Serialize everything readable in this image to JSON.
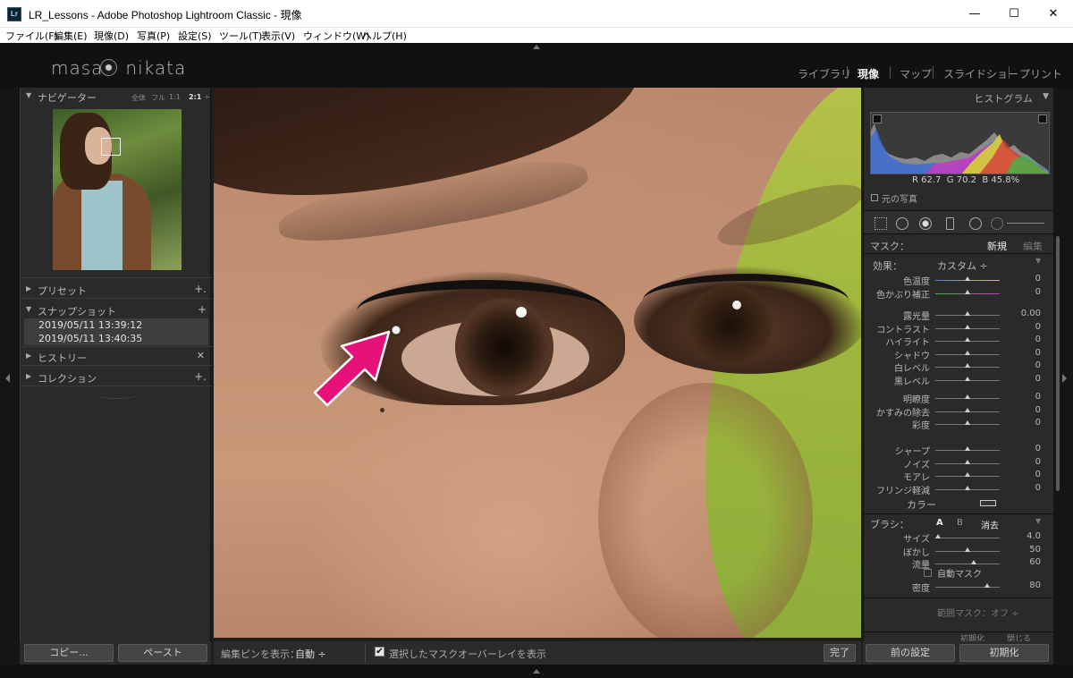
{
  "window": {
    "title": "LR_Lessons - Adobe Photoshop Lightroom Classic - 現像",
    "app_icon": "Lr",
    "minimize": "—",
    "maximize": "☐",
    "close": "✕"
  },
  "menu": {
    "items": [
      "ファイル(F)",
      "編集(E)",
      "現像(D)",
      "写真(P)",
      "設定(S)",
      "ツール(T)",
      "表示(V)",
      "ウィンドウ(W)",
      "ヘルプ(H)"
    ]
  },
  "identity": {
    "brand_left": "masa",
    "brand_right": "nikata"
  },
  "modules": {
    "items": [
      "ライブラリ",
      "現像",
      "マップ",
      "スライドショー",
      "プリント"
    ],
    "active": "現像"
  },
  "left": {
    "navigator": {
      "label": "ナビゲーター",
      "zoom": [
        "全体",
        "フル",
        "1:1",
        "2:1"
      ],
      "zoom_selected": "2:1"
    },
    "presets_label": "プリセット",
    "snapshots_label": "スナップショット",
    "snapshots": [
      "2019/05/11 13:39:12",
      "2019/05/11 13:40:35"
    ],
    "history_label": "ヒストリー",
    "collections_label": "コレクション",
    "copy_button": "コピー...",
    "paste_button": "ペースト"
  },
  "toolbar": {
    "show_pins_label": "編集ピンを表示：",
    "show_pins_value": "自動 ÷",
    "overlay_label": "選択したマスクオーバーレイを表示",
    "overlay_checked": "✔",
    "done_button": "完了"
  },
  "right": {
    "histogram_label": "ヒストグラム",
    "rgb": {
      "r_label": "R",
      "r_value": "62.7",
      "g_label": "G",
      "g_value": "70.2",
      "b_label": "B",
      "b_value": "45.8",
      "unit": "%"
    },
    "original_photo_label": "元の写真",
    "mask_label": "マスク：",
    "mask_new": "新規",
    "mask_edit": "編集",
    "effect_label": "効果：",
    "effect_value": "カスタム ÷",
    "sliders_group1": [
      {
        "label": "色温度",
        "value": "0",
        "pos": 0.5
      },
      {
        "label": "色かぶり補正",
        "value": "0",
        "pos": 0.5
      }
    ],
    "sliders_group2": [
      {
        "label": "露光量",
        "value": "0.00",
        "pos": 0.5
      },
      {
        "label": "コントラスト",
        "value": "0",
        "pos": 0.5
      },
      {
        "label": "ハイライト",
        "value": "0",
        "pos": 0.5
      },
      {
        "label": "シャドウ",
        "value": "0",
        "pos": 0.5
      },
      {
        "label": "白レベル",
        "value": "0",
        "pos": 0.5
      },
      {
        "label": "黒レベル",
        "value": "0",
        "pos": 0.5
      }
    ],
    "sliders_group3": [
      {
        "label": "明瞭度",
        "value": "0",
        "pos": 0.5
      },
      {
        "label": "かすみの除去",
        "value": "0",
        "pos": 0.5
      },
      {
        "label": "彩度",
        "value": "0",
        "pos": 0.5
      }
    ],
    "sliders_group4": [
      {
        "label": "シャープ",
        "value": "0",
        "pos": 0.5
      },
      {
        "label": "ノイズ",
        "value": "0",
        "pos": 0.5
      },
      {
        "label": "モアレ",
        "value": "0",
        "pos": 0.5
      },
      {
        "label": "フリンジ軽減",
        "value": "0",
        "pos": 0.5
      }
    ],
    "color_label": "カラー",
    "brush_label": "ブラシ：",
    "brush_a": "A",
    "brush_b": "B",
    "brush_erase": "消去",
    "brush_sliders": [
      {
        "label": "サイズ",
        "value": "4.0",
        "pos": 0.04
      },
      {
        "label": "ぼかし",
        "value": "50",
        "pos": 0.5
      },
      {
        "label": "流量",
        "value": "60",
        "pos": 0.6
      }
    ],
    "auto_mask_label": "自動マスク",
    "density": {
      "label": "密度",
      "value": "80",
      "pos": 0.8
    },
    "range_mask_label": "範囲マスク：オフ ÷",
    "reset_label": "初期化",
    "close_label": "閉じる",
    "prev_button": "前の設定",
    "reset_button": "初期化"
  },
  "colors": {
    "accent_arrow": "#e6127a",
    "panel_bg": "#2a2a2a",
    "top_bg": "#111111"
  },
  "icons": {
    "pin": "edit-pin-icon",
    "arrow": "annotation-arrow-icon"
  }
}
